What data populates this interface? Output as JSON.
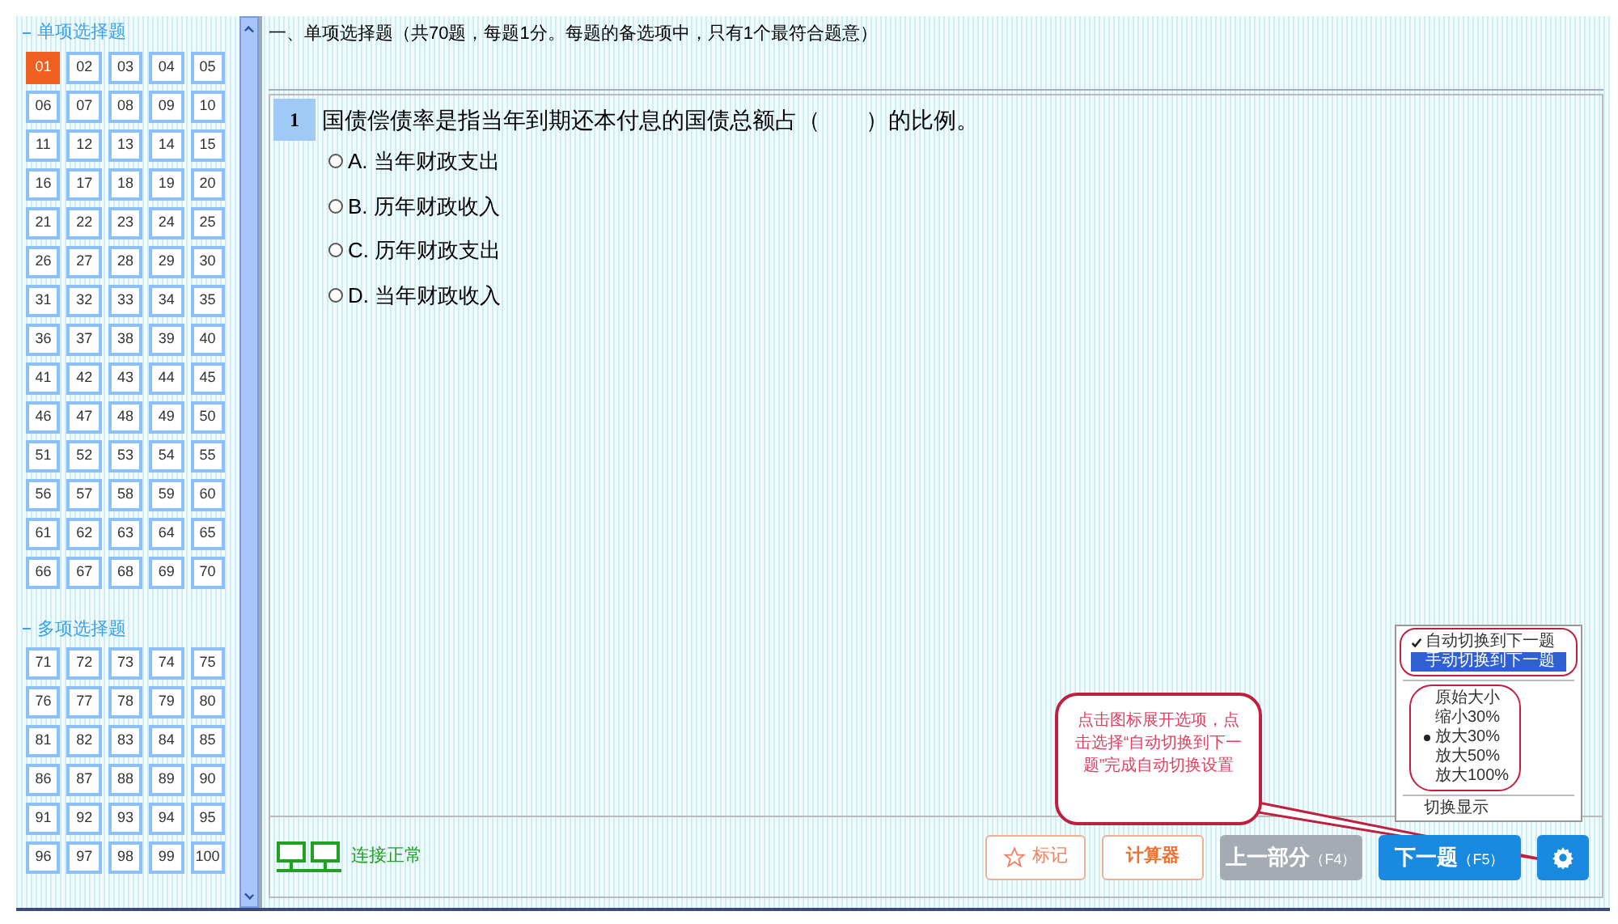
{
  "sections": [
    {
      "title": "单项选择题",
      "items": [
        {
          "label": "01",
          "selected": true
        },
        {
          "label": "02",
          "selected": false
        },
        {
          "label": "03",
          "selected": false
        },
        {
          "label": "04",
          "selected": false
        },
        {
          "label": "05",
          "selected": false
        },
        {
          "label": "06",
          "selected": false
        },
        {
          "label": "07",
          "selected": false
        },
        {
          "label": "08",
          "selected": false
        },
        {
          "label": "09",
          "selected": false
        },
        {
          "label": "10",
          "selected": false
        },
        {
          "label": "11",
          "selected": false
        },
        {
          "label": "12",
          "selected": false
        },
        {
          "label": "13",
          "selected": false
        },
        {
          "label": "14",
          "selected": false
        },
        {
          "label": "15",
          "selected": false
        },
        {
          "label": "16",
          "selected": false
        },
        {
          "label": "17",
          "selected": false
        },
        {
          "label": "18",
          "selected": false
        },
        {
          "label": "19",
          "selected": false
        },
        {
          "label": "20",
          "selected": false
        },
        {
          "label": "21",
          "selected": false
        },
        {
          "label": "22",
          "selected": false
        },
        {
          "label": "23",
          "selected": false
        },
        {
          "label": "24",
          "selected": false
        },
        {
          "label": "25",
          "selected": false
        },
        {
          "label": "26",
          "selected": false
        },
        {
          "label": "27",
          "selected": false
        },
        {
          "label": "28",
          "selected": false
        },
        {
          "label": "29",
          "selected": false
        },
        {
          "label": "30",
          "selected": false
        },
        {
          "label": "31",
          "selected": false
        },
        {
          "label": "32",
          "selected": false
        },
        {
          "label": "33",
          "selected": false
        },
        {
          "label": "34",
          "selected": false
        },
        {
          "label": "35",
          "selected": false
        },
        {
          "label": "36",
          "selected": false
        },
        {
          "label": "37",
          "selected": false
        },
        {
          "label": "38",
          "selected": false
        },
        {
          "label": "39",
          "selected": false
        },
        {
          "label": "40",
          "selected": false
        },
        {
          "label": "41",
          "selected": false
        },
        {
          "label": "42",
          "selected": false
        },
        {
          "label": "43",
          "selected": false
        },
        {
          "label": "44",
          "selected": false
        },
        {
          "label": "45",
          "selected": false
        },
        {
          "label": "46",
          "selected": false
        },
        {
          "label": "47",
          "selected": false
        },
        {
          "label": "48",
          "selected": false
        },
        {
          "label": "49",
          "selected": false
        },
        {
          "label": "50",
          "selected": false
        },
        {
          "label": "51",
          "selected": false
        },
        {
          "label": "52",
          "selected": false
        },
        {
          "label": "53",
          "selected": false
        },
        {
          "label": "54",
          "selected": false
        },
        {
          "label": "55",
          "selected": false
        },
        {
          "label": "56",
          "selected": false
        },
        {
          "label": "57",
          "selected": false
        },
        {
          "label": "58",
          "selected": false
        },
        {
          "label": "59",
          "selected": false
        },
        {
          "label": "60",
          "selected": false
        },
        {
          "label": "61",
          "selected": false
        },
        {
          "label": "62",
          "selected": false
        },
        {
          "label": "63",
          "selected": false
        },
        {
          "label": "64",
          "selected": false
        },
        {
          "label": "65",
          "selected": false
        },
        {
          "label": "66",
          "selected": false
        },
        {
          "label": "67",
          "selected": false
        },
        {
          "label": "68",
          "selected": false
        },
        {
          "label": "69",
          "selected": false
        },
        {
          "label": "70",
          "selected": false
        }
      ]
    },
    {
      "title": "多项选择题",
      "items": [
        {
          "label": "71",
          "selected": false
        },
        {
          "label": "72",
          "selected": false
        },
        {
          "label": "73",
          "selected": false
        },
        {
          "label": "74",
          "selected": false
        },
        {
          "label": "75",
          "selected": false
        },
        {
          "label": "76",
          "selected": false
        },
        {
          "label": "77",
          "selected": false
        },
        {
          "label": "78",
          "selected": false
        },
        {
          "label": "79",
          "selected": false
        },
        {
          "label": "80",
          "selected": false
        },
        {
          "label": "81",
          "selected": false
        },
        {
          "label": "82",
          "selected": false
        },
        {
          "label": "83",
          "selected": false
        },
        {
          "label": "84",
          "selected": false
        },
        {
          "label": "85",
          "selected": false
        },
        {
          "label": "86",
          "selected": false
        },
        {
          "label": "87",
          "selected": false
        },
        {
          "label": "88",
          "selected": false
        },
        {
          "label": "89",
          "selected": false
        },
        {
          "label": "90",
          "selected": false
        },
        {
          "label": "91",
          "selected": false
        },
        {
          "label": "92",
          "selected": false
        },
        {
          "label": "93",
          "selected": false
        },
        {
          "label": "94",
          "selected": false
        },
        {
          "label": "95",
          "selected": false
        },
        {
          "label": "96",
          "selected": false
        },
        {
          "label": "97",
          "selected": false
        },
        {
          "label": "98",
          "selected": false
        },
        {
          "label": "99",
          "selected": false
        },
        {
          "label": "100",
          "selected": false
        }
      ]
    }
  ],
  "header": "一、单项选择题（共70题，每题1分。每题的备选项中，只有1个最符合题意）",
  "question": {
    "number": "1",
    "text": "国债偿债率是指当年到期还本付息的国债总额占（　　）的比例。",
    "options": [
      {
        "label": "A. 当年财政支出",
        "selected": false
      },
      {
        "label": "B. 历年财政收入",
        "selected": false
      },
      {
        "label": "C. 历年财政支出",
        "selected": false
      },
      {
        "label": "D. 当年财政收入",
        "selected": false
      }
    ]
  },
  "status": "连接正常",
  "buttons": [
    {
      "kind": "mark",
      "label": "标记"
    },
    {
      "kind": "calc",
      "label": "计算器"
    },
    {
      "kind": "prev",
      "label": "上一部分",
      "hint": "（F4）",
      "disabled": true
    },
    {
      "kind": "next",
      "label": "下一题",
      "hint": "（F5）",
      "disabled": false
    },
    {
      "kind": "settings"
    }
  ],
  "menu": {
    "groups": [
      [
        {
          "label": "自动切换到下一题",
          "checked": true,
          "selected": false
        },
        {
          "label": "手动切换到下一题",
          "checked": false,
          "selected": true
        }
      ],
      [
        {
          "label": "原始大小",
          "checked": false,
          "selected": false
        },
        {
          "label": "缩小30%",
          "checked": false,
          "selected": false
        },
        {
          "label": "放大30%",
          "checked": true,
          "selected": false
        },
        {
          "label": "放大50%",
          "checked": false,
          "selected": false
        },
        {
          "label": "放大100%",
          "checked": false,
          "selected": false
        }
      ],
      [
        {
          "label": "切换显示",
          "checked": false,
          "selected": false
        }
      ]
    ]
  },
  "callout": "点击图标展开选项，点击选择“自动切换到下一题”完成自动切换设置"
}
